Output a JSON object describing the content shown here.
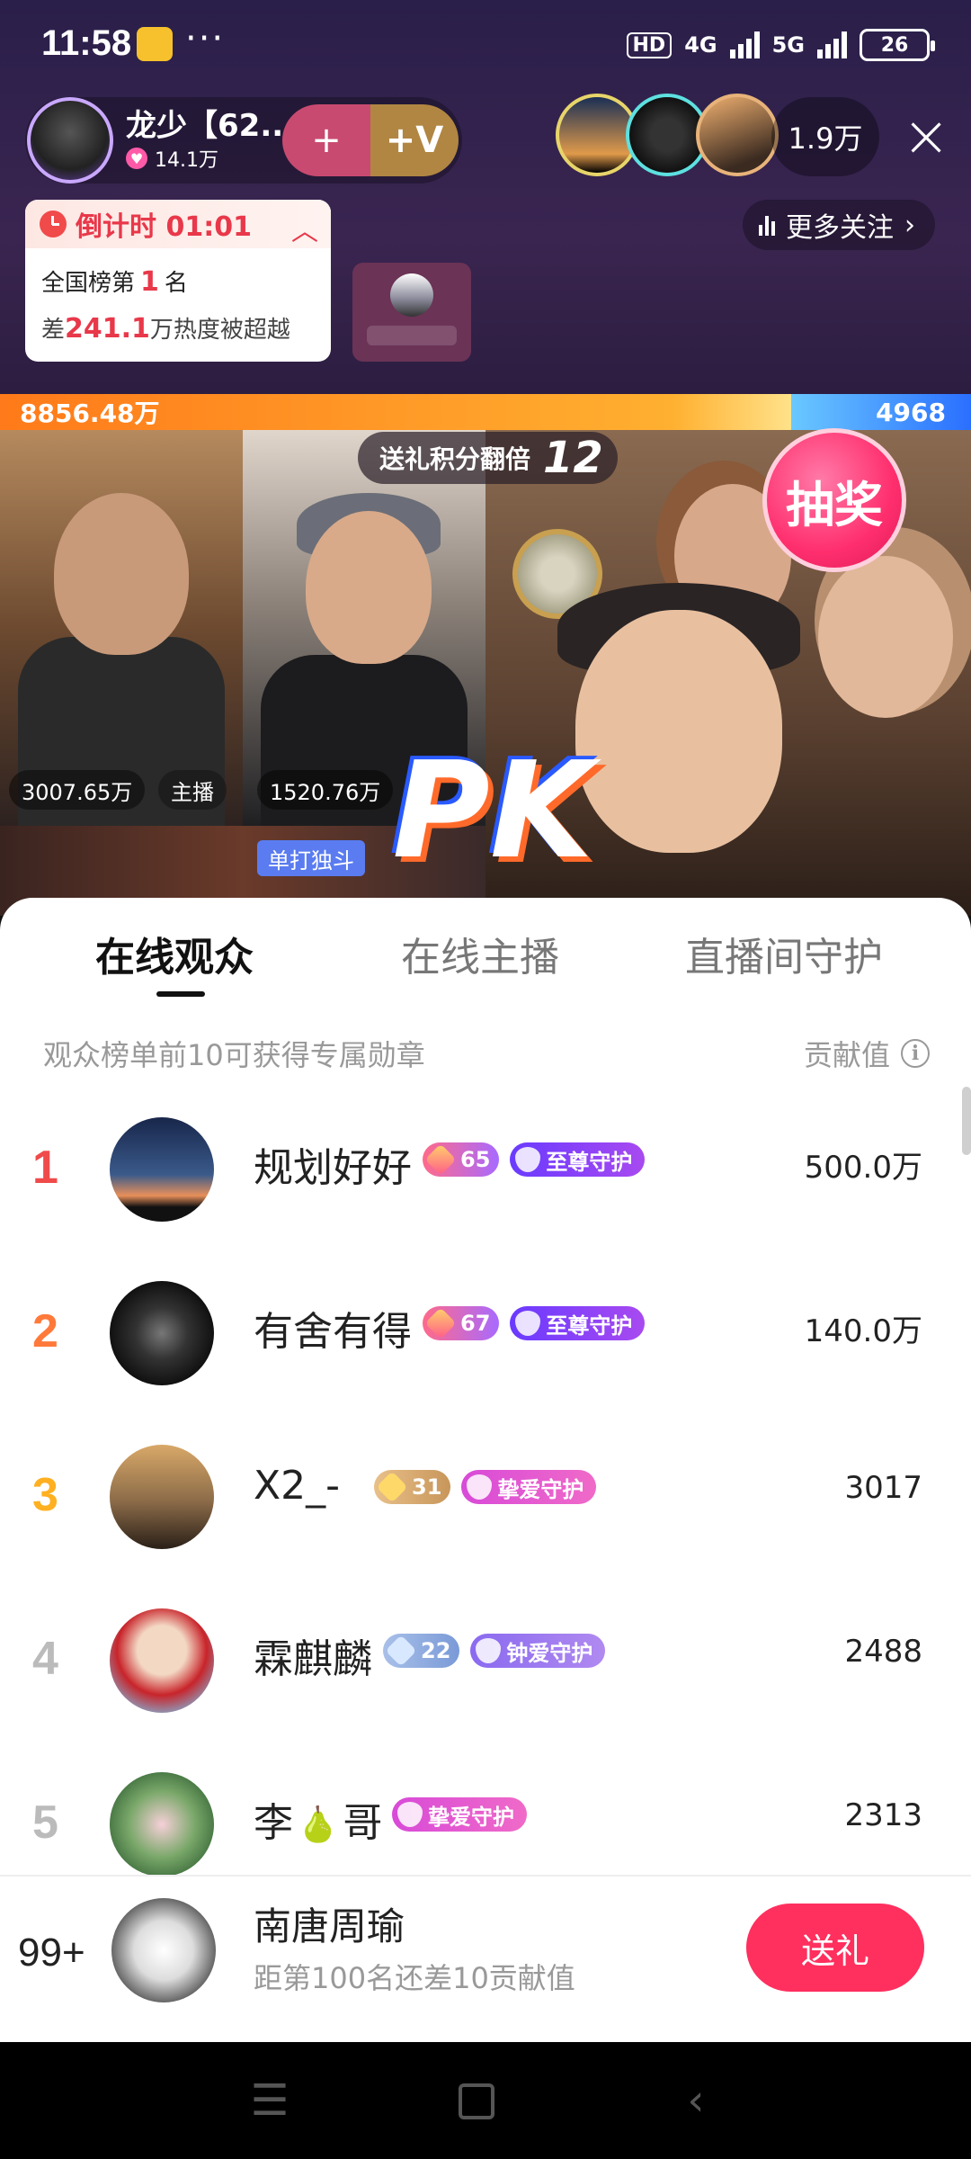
{
  "status_bar": {
    "time": "11:58",
    "dots": "···",
    "hd": "HD",
    "net1": "4G",
    "net2": "5G",
    "battery": "26"
  },
  "host": {
    "name": "龙少【62...",
    "likes": "14.1万",
    "follow_plus": "+",
    "follow_v": "+V"
  },
  "viewers": {
    "count": "1.9万",
    "close_icon": "×"
  },
  "countdown": {
    "title": "倒计时 01:01",
    "rank_prefix": "全国榜第",
    "rank_value": "1",
    "rank_suffix": "名",
    "gap_prefix": "差",
    "gap_value": "241.1",
    "gap_suffix": "万热度被超越"
  },
  "more_follow": "更多关注",
  "pk": {
    "left_score": "8856.48万",
    "right_score": "4968",
    "gift_double_label": "送礼积分翻倍",
    "gift_double_value": "12",
    "lottery": "抽奖",
    "score_host1": "3007.65万",
    "host_tag": "主播",
    "score_host2": "1520.76万",
    "solo_tag": "单打独斗",
    "logo": "PK"
  },
  "sheet": {
    "tabs": [
      "在线观众",
      "在线主播",
      "直播间守护"
    ],
    "sub_header": "观众榜单前10可获得专属勋章",
    "contrib_header": "贡献值",
    "info_icon": "i"
  },
  "ranking": [
    {
      "rank": "1",
      "name": "规划好好",
      "level": "65",
      "guard": "至尊守护",
      "value": "500.0万"
    },
    {
      "rank": "2",
      "name": "有舍有得",
      "level": "67",
      "guard": "至尊守护",
      "value": "140.0万"
    },
    {
      "rank": "3",
      "name": "X2_-",
      "level": "31",
      "guard": "挚爱守护",
      "value": "3017"
    },
    {
      "rank": "4",
      "name": "霖麒麟",
      "level": "22",
      "guard": "钟爱守护",
      "value": "2488"
    },
    {
      "rank": "5",
      "name_a": "李",
      "name_icon": "🍐",
      "name_b": "哥",
      "guard": "挚爱守护",
      "value": "2313"
    }
  ],
  "me": {
    "rank": "99+",
    "name": "南唐周瑜",
    "gap_text": "距第100名还差10贡献值",
    "gift_button": "送礼"
  },
  "nav": {
    "menu_icon": "☰",
    "back_icon": "‹"
  },
  "colors": {
    "accent": "#ff2f5e",
    "rank1": "#f04a4a",
    "rank2": "#ff7a3a",
    "rank3": "#ffb020"
  }
}
